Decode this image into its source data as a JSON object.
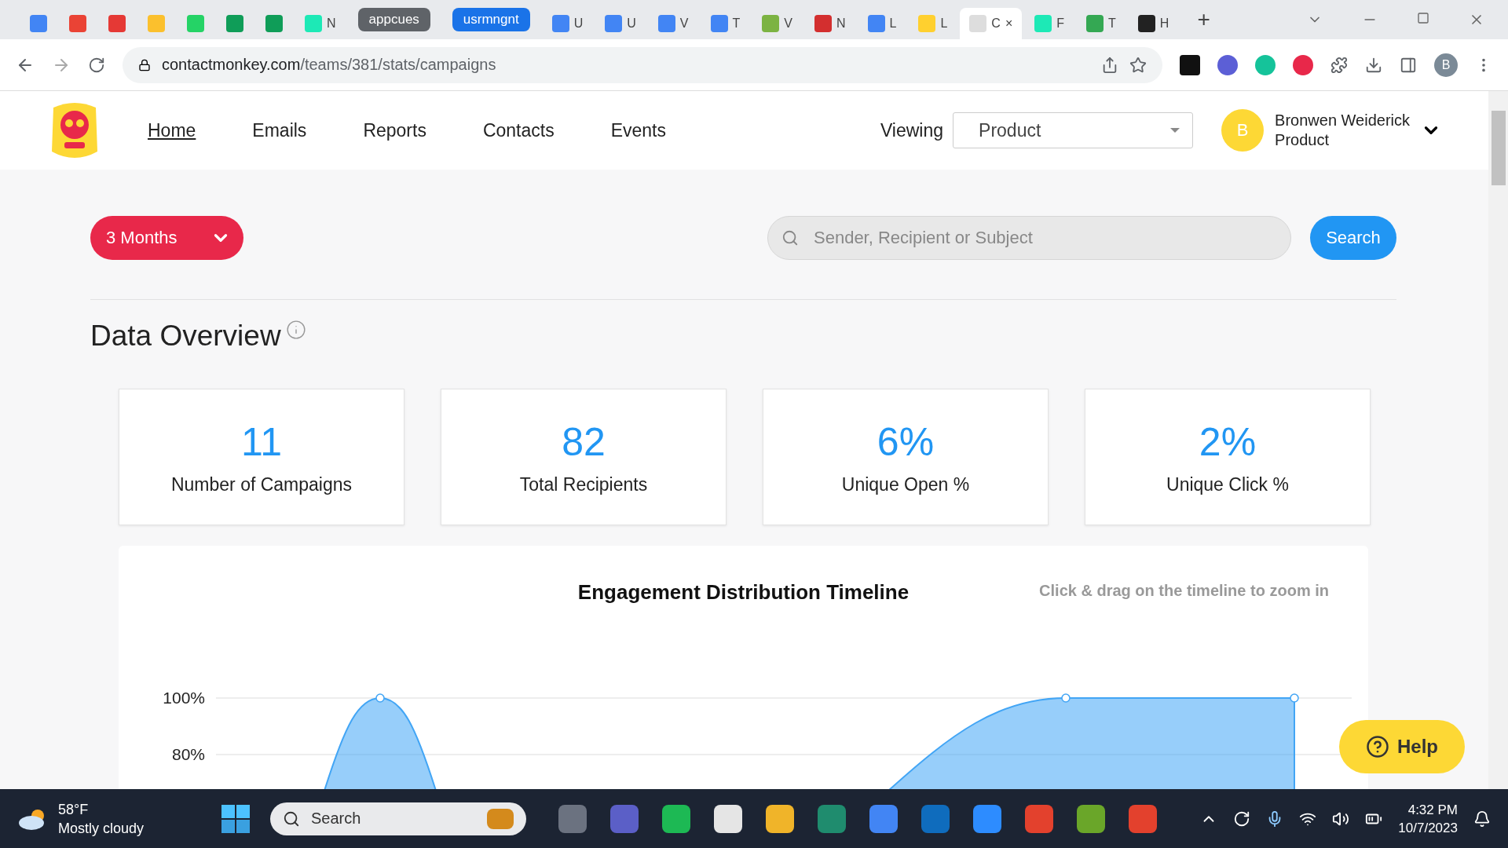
{
  "browser": {
    "tabs": [
      {
        "kind": "calendar",
        "selected": false
      },
      {
        "kind": "gmail",
        "selected": false
      },
      {
        "kind": "check",
        "selected": false
      },
      {
        "kind": "note",
        "selected": false
      },
      {
        "kind": "chat",
        "selected": false
      },
      {
        "kind": "sheet",
        "selected": false
      },
      {
        "kind": "sheet",
        "selected": false
      },
      {
        "kind": "tree",
        "title": "N",
        "selected": false
      },
      {
        "kind": "group",
        "title": "appcues",
        "selected": false
      },
      {
        "kind": "group-blue",
        "title": "usrmngnt",
        "selected": false
      },
      {
        "kind": "doc",
        "title": "U",
        "selected": false
      },
      {
        "kind": "doc",
        "title": "U",
        "selected": false
      },
      {
        "kind": "doc",
        "title": "V",
        "selected": false
      },
      {
        "kind": "doc",
        "title": "T",
        "selected": false
      },
      {
        "kind": "robot",
        "title": "V",
        "selected": false
      },
      {
        "kind": "triangle",
        "title": "N",
        "selected": false
      },
      {
        "kind": "doc",
        "title": "L",
        "selected": false
      },
      {
        "kind": "miro",
        "title": "L",
        "selected": false
      },
      {
        "kind": "blank",
        "title": "C",
        "selected": true
      },
      {
        "kind": "tree",
        "title": "F",
        "selected": false
      },
      {
        "kind": "drive",
        "title": "T",
        "selected": false
      },
      {
        "kind": "letter",
        "title": "H",
        "selected": false
      }
    ],
    "new_tab": "+",
    "close_tab": "×",
    "url_host": "contactmonkey.com",
    "url_path": "/teams/381/stats/campaigns",
    "profile": "B"
  },
  "nav": {
    "items": [
      {
        "label": "Home",
        "selected": true
      },
      {
        "label": "Emails",
        "selected": false
      },
      {
        "label": "Reports",
        "selected": false
      },
      {
        "label": "Contacts",
        "selected": false
      },
      {
        "label": "Events",
        "selected": false
      }
    ],
    "viewing_label": "Viewing",
    "viewing_value": "Product",
    "user": {
      "initial": "B",
      "name": "Bronwen Weiderick",
      "team": "Product"
    }
  },
  "filter": {
    "period": "3 Months"
  },
  "search": {
    "placeholder": "Sender, Recipient or Subject",
    "button": "Search"
  },
  "overview": {
    "title": "Data Overview",
    "stats": [
      {
        "value": "11",
        "label": "Number of Campaigns"
      },
      {
        "value": "82",
        "label": "Total Recipients"
      },
      {
        "value": "6%",
        "label": "Unique Open %"
      },
      {
        "value": "2%",
        "label": "Unique Click %"
      }
    ]
  },
  "chart": {
    "title": "Engagement Distribution Timeline",
    "hint": "Click & drag on the timeline to zoom in",
    "y_labels": [
      "100%",
      "80%"
    ]
  },
  "help": "Help",
  "taskbar": {
    "temperature": "58°F",
    "weather": "Mostly cloudy",
    "search": "Search",
    "time": "4:32 PM",
    "date": "10/7/2023"
  }
}
